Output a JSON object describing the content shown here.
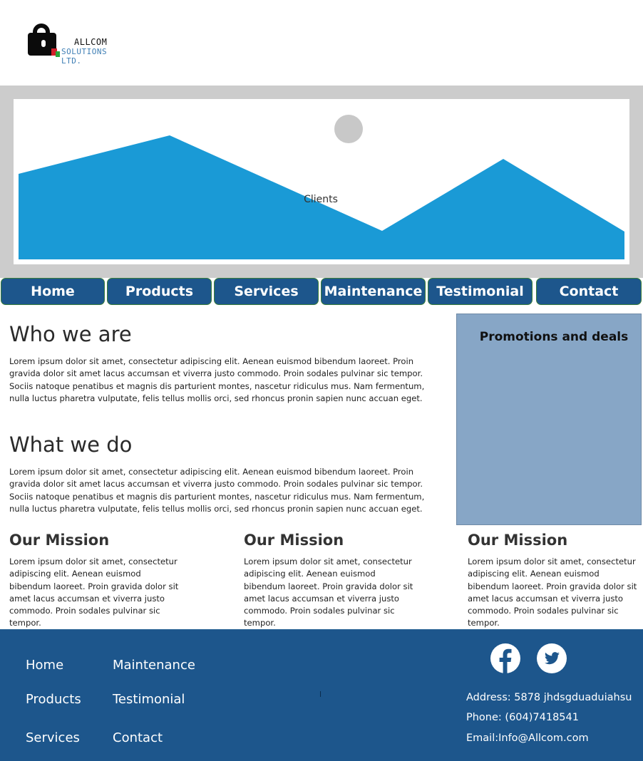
{
  "brand": {
    "name_line1": "ALLCOM",
    "name_line2": "SOLUTIONS LTD."
  },
  "hero": {
    "caption": "Clients"
  },
  "nav": {
    "items": [
      "Home",
      "Products",
      "Services",
      "Maintenance",
      "Testimonial",
      "Contact"
    ]
  },
  "main": {
    "who_title": "Who we are",
    "who_text": "Lorem ipsum dolor sit amet, consectetur adipiscing elit. Aenean euismod bibendum laoreet. Proin gravida dolor sit amet lacus accumsan et viverra justo commodo. Proin sodales pulvinar sic tempor. Sociis natoque penatibus et magnis dis parturient montes, nascetur ridiculus mus. Nam fermentum, nulla luctus pharetra vulputate, felis tellus mollis orci, sed rhoncus pronin sapien nunc accuan eget.",
    "what_title": "What we do",
    "what_text": "Lorem ipsum dolor sit amet, consectetur adipiscing elit. Aenean euismod bibendum laoreet. Proin gravida dolor sit amet lacus accumsan et viverra justo commodo. Proin sodales pulvinar sic tempor. Sociis natoque penatibus et magnis dis parturient montes, nascetur ridiculus mus. Nam fermentum, nulla luctus pharetra vulputate, felis tellus mollis orci, sed rhoncus pronin sapien nunc accuan eget.",
    "missions": [
      {
        "title": "Our Mission",
        "text": "Lorem ipsum dolor sit amet, consectetur adipiscing elit. Aenean euismod bibendum laoreet. Proin gravida dolor sit amet lacus accumsan et viverra justo commodo. Proin sodales pulvinar sic tempor."
      },
      {
        "title": "Our Mission",
        "text": "Lorem ipsum dolor sit amet, consectetur adipiscing elit. Aenean euismod bibendum laoreet. Proin gravida dolor sit amet lacus accumsan et viverra justo commodo. Proin sodales pulvinar sic tempor."
      },
      {
        "title": "Our Mission",
        "text": "Lorem ipsum dolor sit amet, consectetur adipiscing elit. Aenean euismod bibendum laoreet. Proin gravida dolor sit amet lacus accumsan et viverra justo commodo. Proin sodales pulvinar sic tempor."
      }
    ]
  },
  "promo": {
    "title": "Promotions and deals"
  },
  "footer": {
    "links": [
      "Home",
      "Maintenance",
      "Products",
      "Testimonial",
      "Services",
      "Contact"
    ],
    "divider_char": "l",
    "address": "Address: 5878 jhdsgduaduiahsu",
    "phone": "Phone: (604)7418541",
    "email": "Email:Info@Allcom.com",
    "social_icons": [
      "facebook-icon",
      "twitter-icon"
    ]
  },
  "colors": {
    "brand_blue": "#1d568c",
    "hero_blue": "#1a9ad6",
    "promo_bg": "#87a6c6",
    "hero_frame": "#cccccc"
  }
}
